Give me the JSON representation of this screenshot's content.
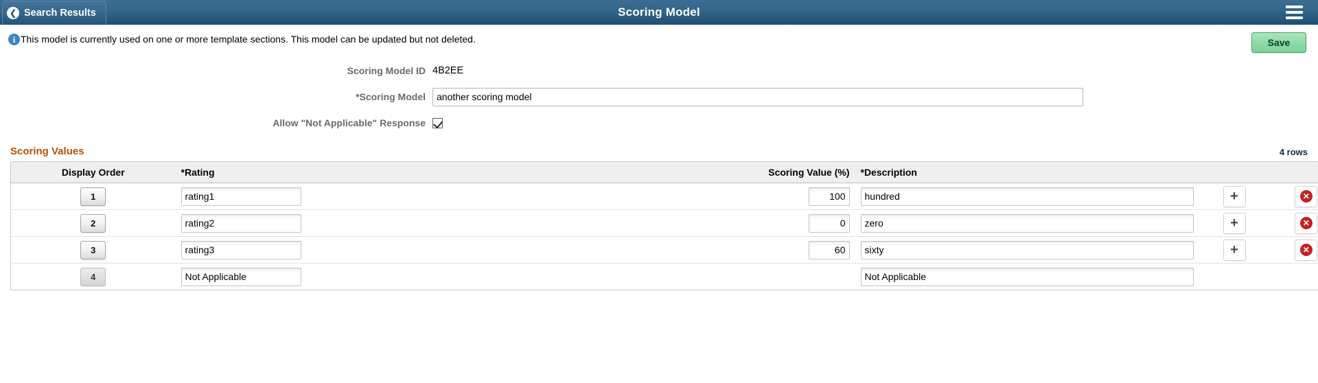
{
  "topbar": {
    "back_label": "Search Results",
    "back_icon": "chevron-left-icon",
    "title": "Scoring Model",
    "menu_icon": "hamburger-menu-icon",
    "bg_color_top": "#3a6e94",
    "bg_color_bottom": "#1f4d71"
  },
  "message": {
    "icon": "info-icon",
    "glyph": "i",
    "text": "This model is currently used on one or more template sections. This model can be updated but not deleted."
  },
  "toolbar": {
    "save_label": "Save",
    "save_color": "#8fdca6"
  },
  "fields": {
    "model_id_label": "Scoring Model ID",
    "model_id_value": "4B2EE",
    "scoring_model_label": "*Scoring Model",
    "scoring_model_value": "another scoring model",
    "scoring_model_placeholder": "",
    "allow_na_label": "Allow \"Not Applicable\" Response",
    "allow_na_checked": "true"
  },
  "grid": {
    "title": "Scoring Values",
    "title_color": "#b35309",
    "row_count_label": "4 rows",
    "columns": [
      {
        "key": "order",
        "label": "Display Order"
      },
      {
        "key": "rating",
        "label": "*Rating"
      },
      {
        "key": "value",
        "label": "Scoring Value (%)"
      },
      {
        "key": "desc",
        "label": "*Description"
      },
      {
        "key": "add",
        "label": ""
      },
      {
        "key": "del",
        "label": ""
      }
    ],
    "add_icon": "plus-icon",
    "delete_icon": "delete-circle-icon",
    "delete_glyph": "✕",
    "add_glyph": "+",
    "rows": [
      {
        "order": "1",
        "rating": "rating1",
        "value": "100",
        "desc": "hundred",
        "has_value_field": "true",
        "has_buttons": "true",
        "order_disabled": "false"
      },
      {
        "order": "2",
        "rating": "rating2",
        "value": "0",
        "desc": "zero",
        "has_value_field": "true",
        "has_buttons": "true",
        "order_disabled": "false"
      },
      {
        "order": "3",
        "rating": "rating3",
        "value": "60",
        "desc": "sixty",
        "has_value_field": "true",
        "has_buttons": "true",
        "order_disabled": "false"
      },
      {
        "order": "4",
        "rating": "Not Applicable",
        "value": "",
        "desc": "Not Applicable",
        "has_value_field": "false",
        "has_buttons": "false",
        "order_disabled": "true"
      }
    ]
  }
}
